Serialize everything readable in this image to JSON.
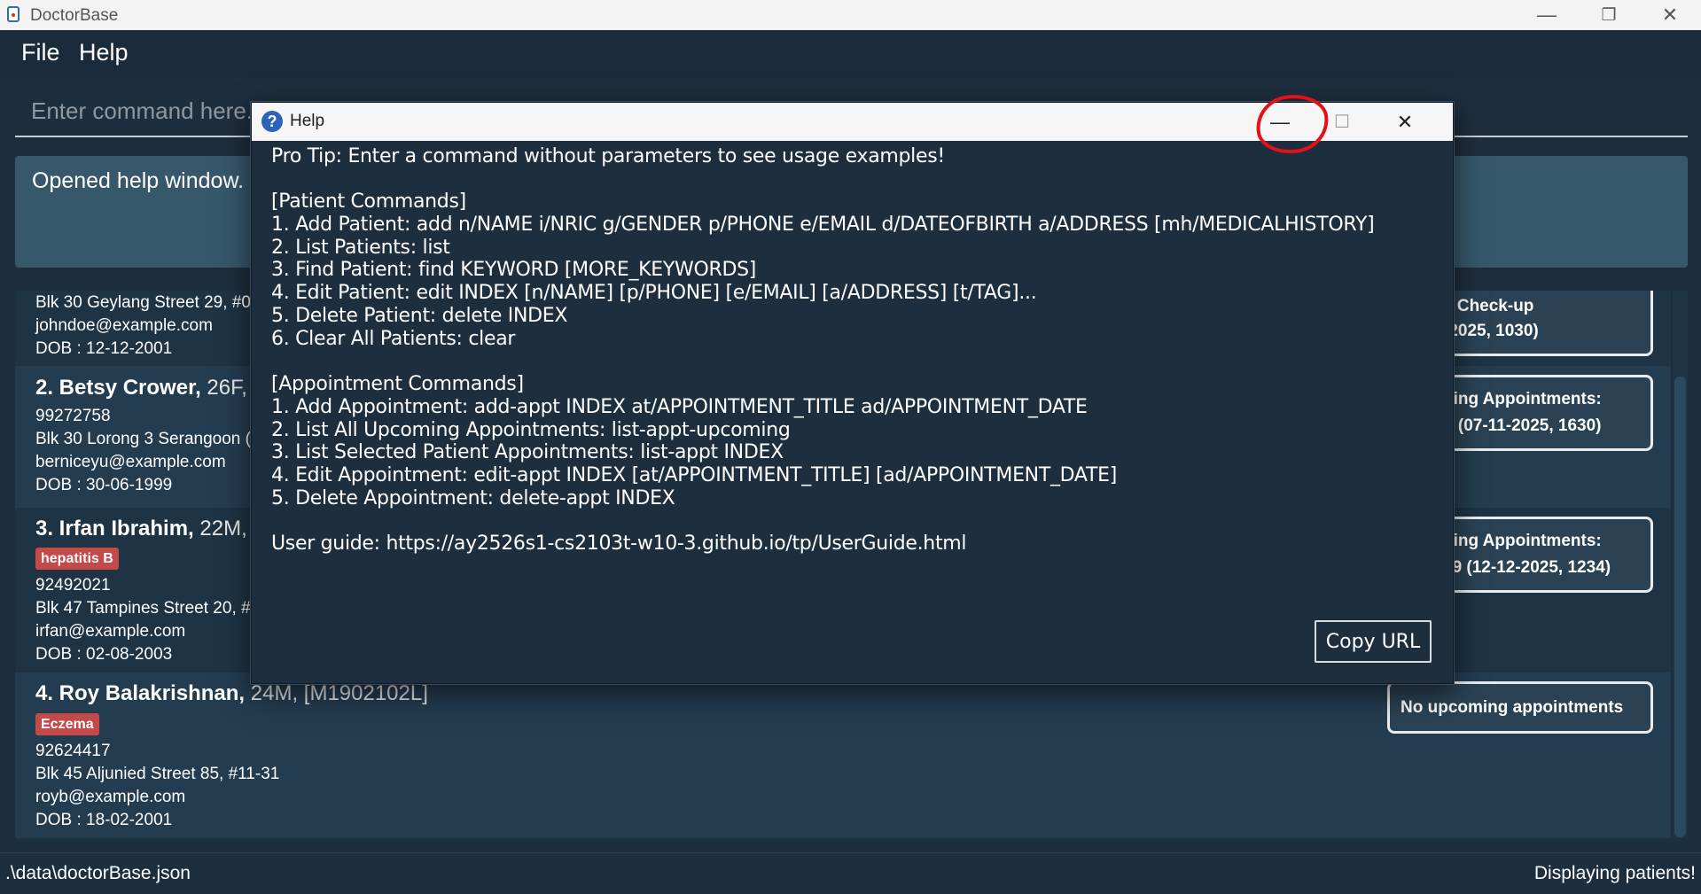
{
  "window": {
    "title": "DoctorBase",
    "controls": {
      "minimize": "—",
      "restore": "❐",
      "close": "✕"
    }
  },
  "menu": {
    "items": [
      "File",
      "Help"
    ]
  },
  "command_box": {
    "placeholder": "Enter command here..."
  },
  "result_display": {
    "text": "Opened help window."
  },
  "patients": [
    {
      "phone_hidden": true,
      "address": "Blk 30 Geylang Street 29, #0",
      "email": "johndoe@example.com",
      "dob": "DOB : 12-12-2001",
      "appt_lines": [
        "e Check-up",
        "-2025, 1030)"
      ]
    },
    {
      "name": "2. Betsy Crower,",
      "rest": " 26F, [",
      "phone": "99272758",
      "address": "Blk 30 Lorong 3 Serangoon (",
      "email": "berniceyu@example.com",
      "dob": "DOB : 30-06-1999",
      "appt_lines": [
        "ning Appointments:",
        "p (07-11-2025, 1630)"
      ]
    },
    {
      "name": "3. Irfan Ibrahim,",
      "rest": " 22M,",
      "tag": "hepatitis B",
      "phone": "92492021",
      "address": "Blk 47 Tampines Street 20, #",
      "email": "irfan@example.com",
      "dob": "DOB : 02-08-2003",
      "appt_lines": [
        "ning Appointments:",
        "19 (12-12-2025, 1234)"
      ]
    },
    {
      "name": "4. Roy Balakrishnan,",
      "rest": " 24M, [M1902102L]",
      "tag": "Eczema",
      "phone": "92624417",
      "address": "Blk 45 Aljunied Street 85, #11-31",
      "email": "royb@example.com",
      "dob": "DOB : 18-02-2001",
      "appt_lines": [
        "No upcoming appointments"
      ]
    }
  ],
  "status_bar": {
    "left": ".\\data\\doctorBase.json",
    "right": "Displaying patients!"
  },
  "help_dialog": {
    "title": "Help",
    "icon": "question-icon",
    "controls": {
      "minimize": "—",
      "maximize": "☐",
      "close": "✕"
    },
    "lines": [
      "Pro Tip: Enter a command without parameters to see usage examples!",
      "",
      "[Patient Commands]",
      "1. Add Patient: add n/NAME i/NRIC g/GENDER p/PHONE e/EMAIL d/DATEOFBIRTH a/ADDRESS [mh/MEDICALHISTORY]",
      "2. List Patients: list",
      "3. Find Patient: find KEYWORD [MORE_KEYWORDS]",
      "4. Edit Patient: edit INDEX [n/NAME] [p/PHONE] [e/EMAIL] [a/ADDRESS] [t/TAG]...",
      "5. Delete Patient: delete INDEX",
      "6. Clear All Patients: clear",
      "",
      "[Appointment Commands]",
      "1. Add Appointment: add-appt INDEX at/APPOINTMENT_TITLE ad/APPOINTMENT_DATE",
      "2. List All Upcoming Appointments: list-appt-upcoming",
      "3. List Selected Patient Appointments: list-appt INDEX",
      "4. Edit Appointment: edit-appt INDEX [at/APPOINTMENT_TITLE] [ad/APPOINTMENT_DATE]",
      "5. Delete Appointment: delete-appt INDEX",
      "",
      "User guide: https://ay2526s1-cs2103t-w10-3.github.io/tp/UserGuide.html"
    ],
    "copy_button": "Copy URL"
  },
  "annotation": {
    "color": "#e4111b"
  },
  "colors": {
    "accent": "#37576b",
    "tag": "#c44a4a",
    "background": "#1d2e3e"
  }
}
